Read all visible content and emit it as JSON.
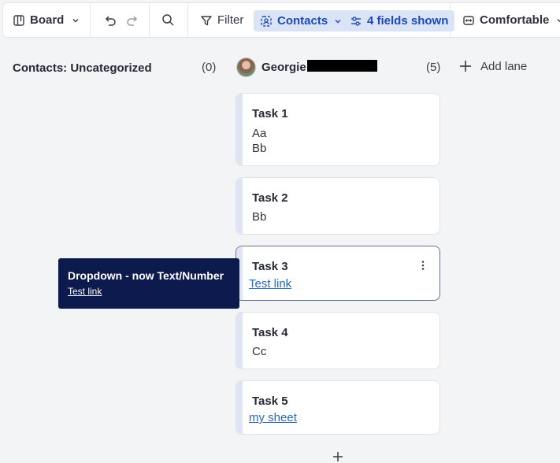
{
  "toolbar": {
    "view_label": "Board",
    "filter_label": "Filter",
    "group_label": "Contacts",
    "fields_label": "4 fields shown",
    "density_label": "Comfortable"
  },
  "lanes": [
    {
      "title": "Contacts: Uncategorized",
      "count": "(0)"
    },
    {
      "title": "Georgie",
      "count": "(5)"
    }
  ],
  "add_lane_label": "Add lane",
  "cards": [
    {
      "title": "Task 1",
      "fields": [
        "Aa",
        "Bb"
      ]
    },
    {
      "title": "Task 2",
      "fields": [
        "Bb"
      ]
    },
    {
      "title": "Task 3",
      "link": "Test link"
    },
    {
      "title": "Task 4",
      "fields": [
        "Cc"
      ]
    },
    {
      "title": "Task 5",
      "link": "my sheet"
    }
  ],
  "tooltip": {
    "title": "Dropdown - now Text/Number",
    "link": "Test link"
  },
  "colors": {
    "accent": "#1c4ab8",
    "chip_bg": "#dbe4f7",
    "tooltip_bg": "#0d1a4d",
    "link": "#2a67b8"
  }
}
